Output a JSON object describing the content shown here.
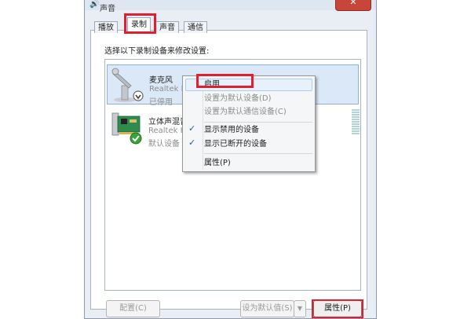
{
  "window": {
    "title": "声音",
    "close_label": "✕"
  },
  "tabs": [
    {
      "label": "播放"
    },
    {
      "label": "录制"
    },
    {
      "label": "声音"
    },
    {
      "label": "通信"
    }
  ],
  "instruction": "选择以下录制设备来修改设置:",
  "devices": [
    {
      "name": "麦克风",
      "vendor": "Realtek H",
      "status": "已停用"
    },
    {
      "name": "立体声混音",
      "vendor": "Realtek H",
      "status": "默认设备"
    }
  ],
  "context_menu": {
    "items": [
      {
        "label": "启用"
      },
      {
        "label": "设置为默认设备(D)"
      },
      {
        "label": "设置为默认通信设备(C)"
      },
      {
        "label": "显示禁用的设备",
        "checked": true
      },
      {
        "label": "显示已断开的设备",
        "checked": true
      },
      {
        "label": "属性(P)"
      }
    ],
    "check_mark": "✓"
  },
  "buttons": {
    "configure": "配置(C)",
    "set_default": "设为默认值(S)",
    "dropdown_arrow": "▼",
    "properties": "属性(P)"
  },
  "colors": {
    "highlight_red": "#e0202f",
    "selection_blue": "#dbe8f7"
  }
}
